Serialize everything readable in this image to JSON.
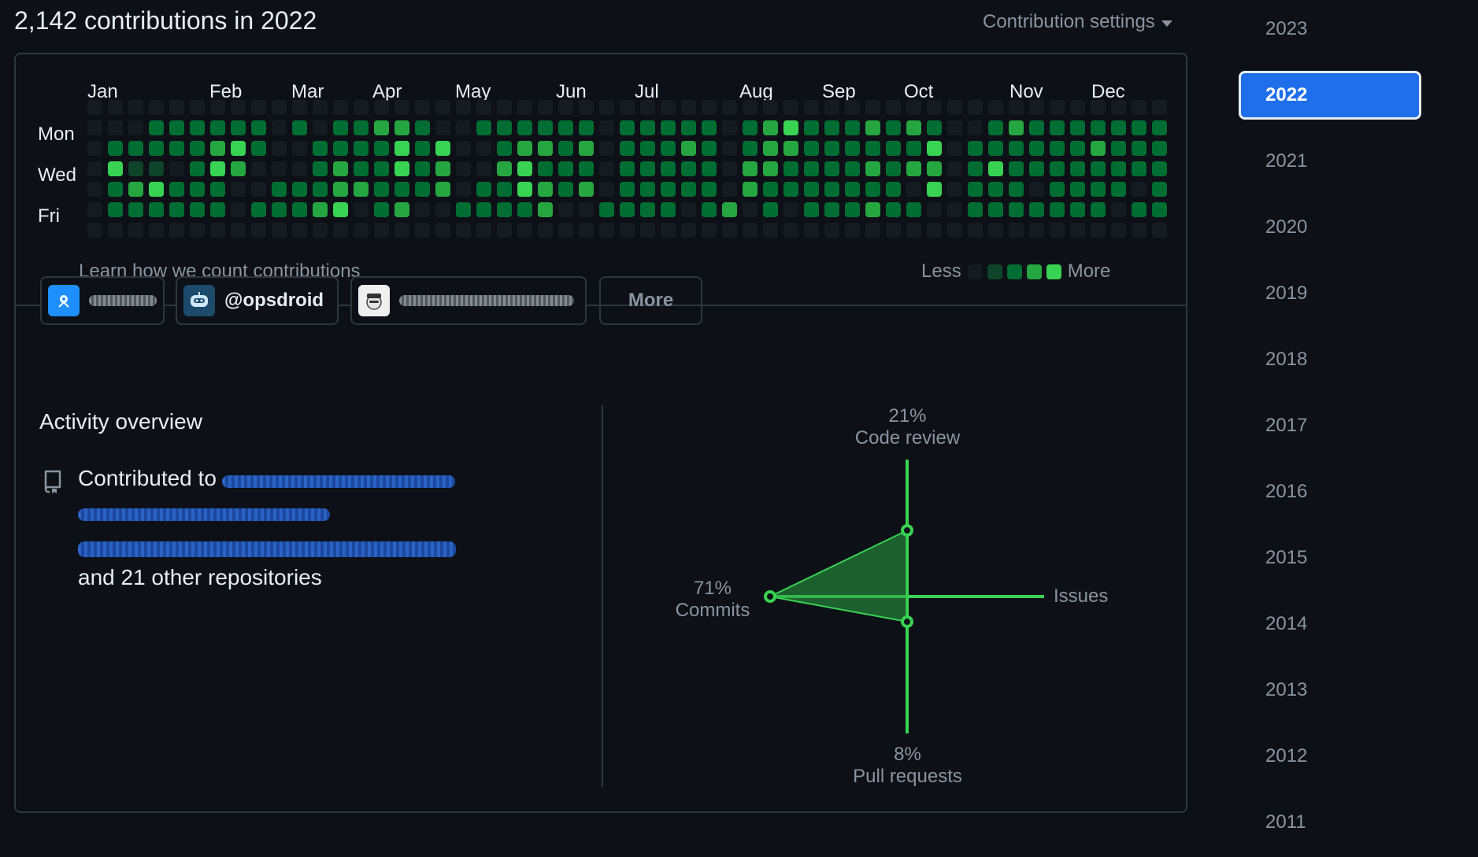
{
  "header": {
    "title": "2,142 contributions in 2022",
    "settings_label": "Contribution settings"
  },
  "graph": {
    "months": [
      "Jan",
      "Feb",
      "Mar",
      "Apr",
      "May",
      "Jun",
      "Jul",
      "Aug",
      "Sep",
      "Oct",
      "Nov",
      "Dec"
    ],
    "weekdays": [
      "Mon",
      "Wed",
      "Fri"
    ],
    "learn_link": "Learn how we count contributions",
    "legend_less": "Less",
    "legend_more": "More",
    "level_colors": [
      "#161b22",
      "#0e4429",
      "#006d32",
      "#26a641",
      "#39d353"
    ],
    "weeks": [
      [
        0,
        0,
        0,
        0,
        0,
        0,
        0
      ],
      [
        0,
        0,
        2,
        4,
        2,
        2,
        0
      ],
      [
        0,
        0,
        2,
        1,
        3,
        2,
        0
      ],
      [
        0,
        2,
        2,
        1,
        4,
        2,
        0
      ],
      [
        0,
        2,
        2,
        0,
        2,
        2,
        0
      ],
      [
        0,
        2,
        2,
        2,
        2,
        2,
        0
      ],
      [
        0,
        2,
        3,
        4,
        2,
        2,
        0
      ],
      [
        0,
        2,
        4,
        3,
        0,
        0,
        0
      ],
      [
        0,
        2,
        2,
        0,
        0,
        2,
        0
      ],
      [
        0,
        0,
        0,
        0,
        2,
        2,
        0
      ],
      [
        0,
        2,
        0,
        0,
        2,
        2,
        0
      ],
      [
        0,
        0,
        2,
        2,
        2,
        3,
        0
      ],
      [
        0,
        2,
        2,
        3,
        3,
        4,
        0
      ],
      [
        0,
        2,
        2,
        2,
        3,
        0,
        0
      ],
      [
        0,
        3,
        2,
        2,
        2,
        2,
        0
      ],
      [
        0,
        3,
        4,
        4,
        2,
        3,
        0
      ],
      [
        0,
        2,
        2,
        2,
        2,
        0,
        0
      ],
      [
        0,
        0,
        4,
        3,
        3,
        0,
        0
      ],
      [
        0,
        0,
        0,
        0,
        0,
        2,
        0
      ],
      [
        0,
        2,
        0,
        0,
        2,
        2,
        0
      ],
      [
        0,
        2,
        2,
        3,
        2,
        2,
        0
      ],
      [
        0,
        2,
        3,
        4,
        4,
        2,
        0
      ],
      [
        0,
        2,
        3,
        2,
        3,
        3,
        0
      ],
      [
        0,
        2,
        2,
        2,
        2,
        0,
        0
      ],
      [
        0,
        2,
        3,
        2,
        3,
        0,
        0
      ],
      [
        0,
        0,
        0,
        0,
        0,
        2,
        0
      ],
      [
        0,
        2,
        2,
        2,
        2,
        2,
        0
      ],
      [
        0,
        2,
        2,
        2,
        2,
        2,
        0
      ],
      [
        0,
        2,
        2,
        2,
        2,
        2,
        0
      ],
      [
        0,
        2,
        3,
        2,
        2,
        0,
        0
      ],
      [
        0,
        2,
        2,
        2,
        2,
        2,
        0
      ],
      [
        0,
        0,
        0,
        0,
        0,
        3,
        0
      ],
      [
        0,
        2,
        2,
        3,
        3,
        0,
        0
      ],
      [
        0,
        3,
        3,
        3,
        2,
        2,
        0
      ],
      [
        0,
        4,
        3,
        2,
        2,
        0,
        0
      ],
      [
        0,
        2,
        2,
        2,
        2,
        2,
        0
      ],
      [
        0,
        2,
        2,
        2,
        2,
        2,
        0
      ],
      [
        0,
        2,
        2,
        2,
        2,
        2,
        0
      ],
      [
        0,
        3,
        2,
        3,
        2,
        3,
        0
      ],
      [
        0,
        2,
        2,
        2,
        2,
        2,
        0
      ],
      [
        0,
        3,
        2,
        3,
        0,
        2,
        0
      ],
      [
        0,
        2,
        4,
        3,
        4,
        0,
        0
      ],
      [
        0,
        0,
        0,
        0,
        0,
        0,
        0
      ],
      [
        0,
        0,
        2,
        2,
        2,
        2,
        0
      ],
      [
        0,
        2,
        2,
        4,
        2,
        2,
        0
      ],
      [
        0,
        3,
        2,
        2,
        2,
        2,
        0
      ],
      [
        0,
        2,
        2,
        2,
        0,
        2,
        0
      ],
      [
        0,
        2,
        2,
        2,
        2,
        2,
        0
      ],
      [
        0,
        2,
        2,
        2,
        2,
        2,
        0
      ],
      [
        0,
        2,
        3,
        2,
        2,
        2,
        0
      ],
      [
        0,
        2,
        2,
        2,
        2,
        0,
        0
      ],
      [
        0,
        2,
        2,
        2,
        0,
        2,
        0
      ],
      [
        0,
        2,
        2,
        2,
        2,
        2,
        0
      ]
    ]
  },
  "organizations": {
    "org2_name": "@opsdroid",
    "more_label": "More"
  },
  "overview": {
    "title": "Activity overview",
    "contributed_prefix": "Contributed to",
    "other_repos": "and 21 other repositories"
  },
  "radar": {
    "code_review_pct": "21%",
    "code_review_label": "Code review",
    "commits_pct": "71%",
    "commits_label": "Commits",
    "pull_requests_pct": "8%",
    "pull_requests_label": "Pull requests",
    "issues_label": "Issues",
    "values": {
      "code_review": 21,
      "commits": 71,
      "pull_requests": 8,
      "issues": 0
    },
    "color": "#39d353"
  },
  "years": {
    "items": [
      "2023",
      "2022",
      "2021",
      "2020",
      "2019",
      "2018",
      "2017",
      "2016",
      "2015",
      "2014",
      "2013",
      "2012",
      "2011"
    ],
    "active": "2022"
  }
}
